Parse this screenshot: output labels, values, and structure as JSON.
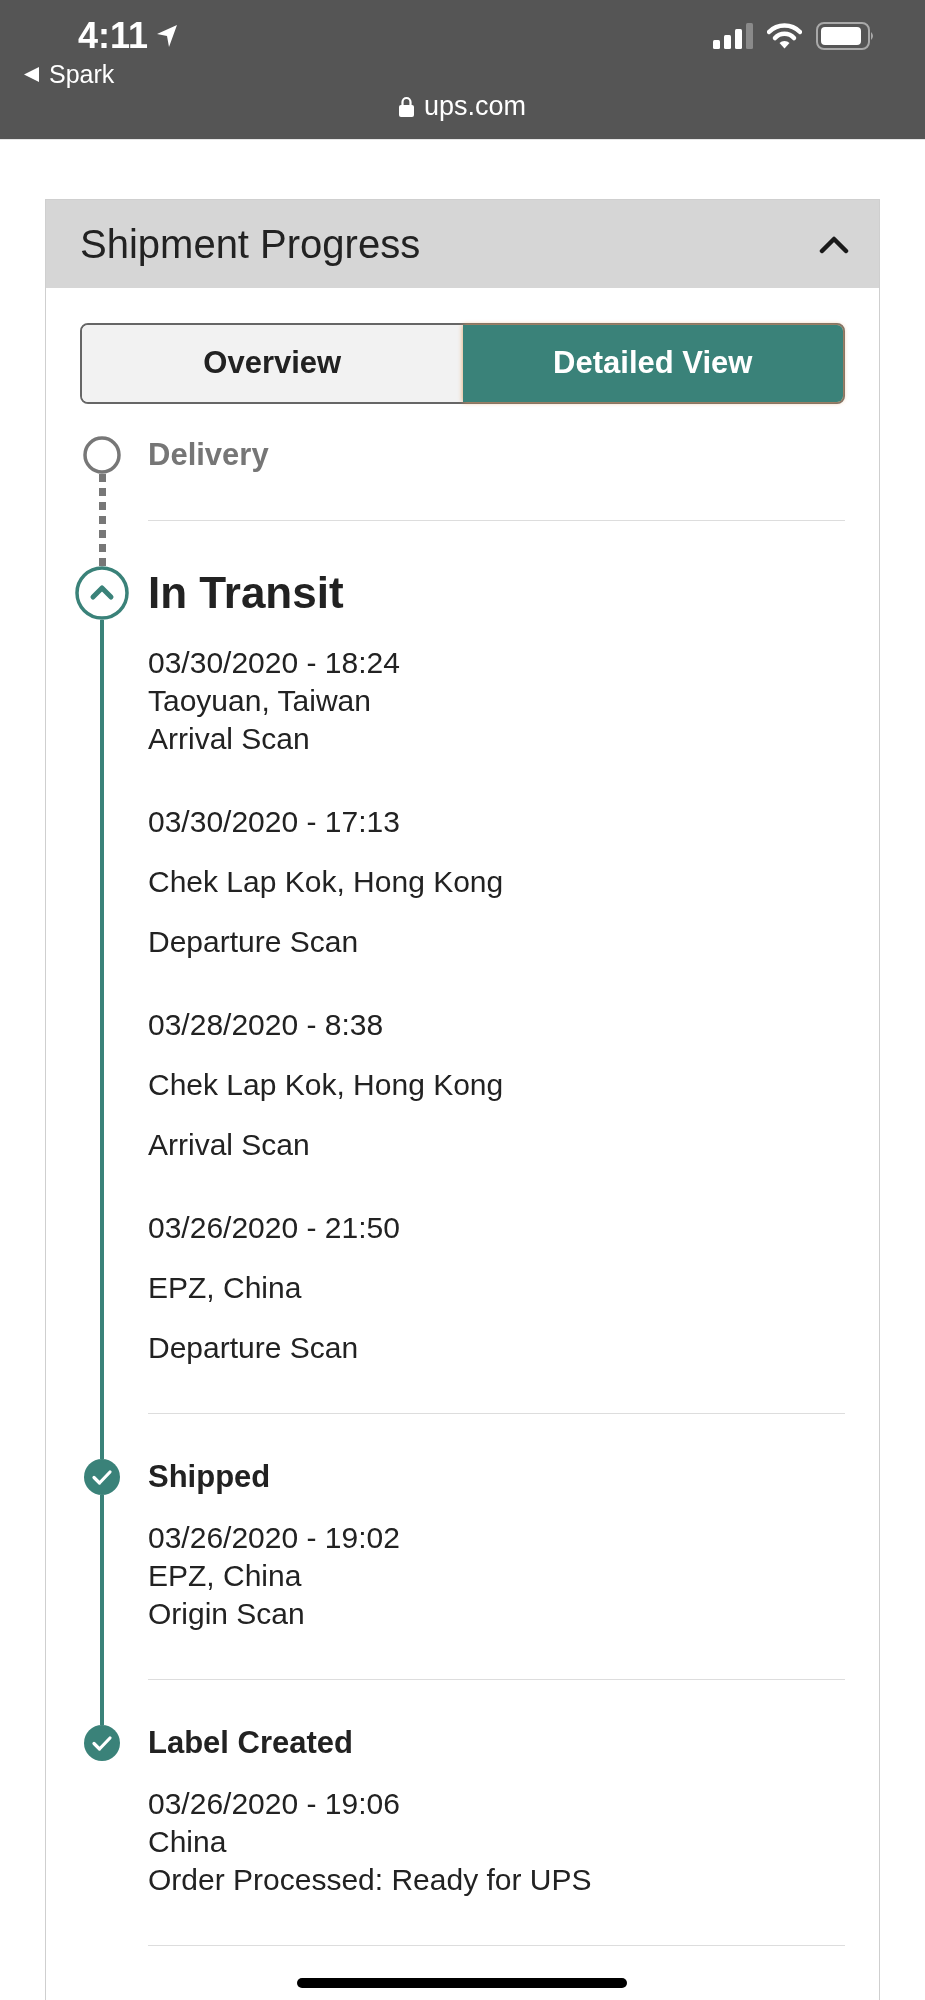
{
  "status_bar": {
    "time": "4:11",
    "back_label": "Spark",
    "url": "ups.com"
  },
  "panel": {
    "title": "Shipment Progress",
    "expanded": true,
    "tabs": [
      {
        "label": "Overview",
        "selected": false
      },
      {
        "label": "Detailed View",
        "selected": true
      }
    ],
    "milestones": [
      {
        "kind": "pending",
        "title": "Delivery"
      },
      {
        "kind": "current",
        "title": "In Transit",
        "events": [
          {
            "kind": "compact",
            "date": "03/30/2020 - 18:24",
            "location": "Taoyuan, Taiwan",
            "activity": "Arrival Scan"
          },
          {
            "kind": "spaced",
            "date": "03/30/2020 - 17:13",
            "location": "Chek Lap Kok, Hong Kong",
            "activity": "Departure Scan"
          },
          {
            "kind": "spaced",
            "date": "03/28/2020 - 8:38",
            "location": "Chek Lap Kok, Hong Kong",
            "activity": "Arrival Scan"
          },
          {
            "kind": "spaced",
            "date": "03/26/2020 - 21:50",
            "location": "EPZ, China",
            "activity": "Departure Scan"
          }
        ]
      },
      {
        "kind": "done",
        "title": "Shipped",
        "events": [
          {
            "kind": "compact",
            "date": "03/26/2020 - 19:02",
            "location": "EPZ, China",
            "activity": "Origin Scan"
          }
        ]
      },
      {
        "kind": "done",
        "title": "Label Created",
        "events": [
          {
            "kind": "compact",
            "date": "03/26/2020 - 19:06",
            "location": "China",
            "activity": "Order Processed: Ready for UPS"
          }
        ]
      }
    ]
  }
}
